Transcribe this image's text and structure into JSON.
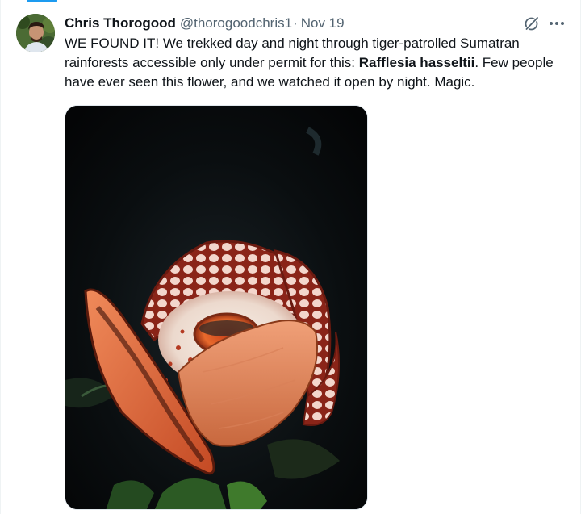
{
  "tweet": {
    "author": {
      "display_name": "Chris Thorogood",
      "handle": "@thorogoodchris1"
    },
    "separator": "·",
    "date": "Nov 19",
    "text_part1": "WE FOUND IT! We trekked day and night through tiger-patrolled Sumatran rainforests accessible only under permit for this: ",
    "text_bold": "Rafflesia hasseltii",
    "text_part2": ". Few people have ever seen this flower, and we watched it open by night. Magic.",
    "actions": {
      "grok_icon": "grok-icon",
      "more_icon": "more-icon"
    },
    "media": {
      "subject": "rafflesia-flower-photo"
    }
  },
  "colors": {
    "accent": "#1d9bf0",
    "text_primary": "#0f1419",
    "text_secondary": "#536471"
  }
}
